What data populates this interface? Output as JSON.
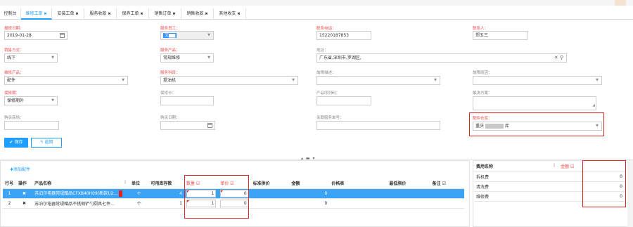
{
  "tabs": [
    {
      "label": "控制台",
      "closable": false,
      "active": false
    },
    {
      "label": "维修工单",
      "closable": true,
      "active": true
    },
    {
      "label": "安装工单",
      "closable": true,
      "active": false
    },
    {
      "label": "服务收款",
      "closable": true,
      "active": false
    },
    {
      "label": "保养工单",
      "closable": true,
      "active": false
    },
    {
      "label": "销售订单",
      "closable": true,
      "active": false
    },
    {
      "label": "销售收款",
      "closable": true,
      "active": false
    },
    {
      "label": "其他收支",
      "closable": true,
      "active": false
    }
  ],
  "form": {
    "report_date": {
      "label": "报修日期：",
      "value": "2019-01-28"
    },
    "service_staff": {
      "label": "服务员工：",
      "value": "文"
    },
    "phone": {
      "label": "联系电话：",
      "value": "15220187853"
    },
    "contact": {
      "label": "联系人：",
      "value": "郑五三"
    },
    "sale_method": {
      "label": "销售方式：",
      "value": "线下"
    },
    "service_product": {
      "label": "服务产品：",
      "value": "常规维修"
    },
    "address": {
      "label": "地址：",
      "value": "广东省,深圳市,罗湖区,"
    },
    "repair_product": {
      "label": "维修产品：",
      "value": "配件"
    },
    "service_subject": {
      "label": "服务科目：",
      "value": "提油机"
    },
    "fault_desc": {
      "label": "故障描述：",
      "value": ""
    },
    "fault_reason": {
      "label": "故障原因：",
      "value": ""
    },
    "warranty": {
      "label": "保修期：",
      "value": "保修期外"
    },
    "warranty_card": {
      "label": "保修卡：",
      "value": ""
    },
    "product_serial": {
      "label": "产品序列码：",
      "value": ""
    },
    "solution": {
      "label": "解决方案：",
      "value": ""
    },
    "purchase_store": {
      "label": "购买商场：",
      "value": ""
    },
    "purchase_date": {
      "label": "购买日期：",
      "value": ""
    },
    "related_service_no": {
      "label": "关联服务单号：",
      "value": ""
    },
    "parts_warehouse": {
      "label": "配件仓库：",
      "value_prefix": "重庆",
      "value_suffix": "库"
    }
  },
  "buttons": {
    "save": "✔ 保存",
    "back": "↰ 返回",
    "add_part": "✚添加配件"
  },
  "parts_table": {
    "headers": [
      "行号",
      "操作",
      "产品名称",
      "单位",
      "可用库存数",
      "数量 ☑",
      "单价 ☑",
      "标准供价",
      "金额",
      "价格表",
      "最低限价",
      "备注 ☑"
    ],
    "rows": [
      {
        "no": "1",
        "op": "✖",
        "name": "苏泊尔电器常规赠品CFXB40H09(新款)/2...",
        "unit": "个",
        "stock": "4",
        "qty": "1",
        "price": "0",
        "std": "",
        "amount": "0",
        "pricelist": "",
        "minprice": "",
        "remark": ""
      },
      {
        "no": "2",
        "op": "✖",
        "name": "苏泊尔电器常规赠品不锈钢铲勺厨具七件...",
        "unit": "个",
        "stock": "1",
        "qty": "1",
        "price": "0",
        "std": "",
        "amount": "0",
        "pricelist": "",
        "minprice": "",
        "remark": ""
      }
    ]
  },
  "fee_table": {
    "headers": [
      "费用名称",
      "金额 ☑"
    ],
    "rows": [
      {
        "name": "拆机费",
        "amount": "0"
      },
      {
        "name": "清洗费",
        "amount": "0"
      },
      {
        "name": "维修费",
        "amount": "0"
      }
    ]
  },
  "colors": {
    "accent": "#1e9fff",
    "required_label": "#ee4b4b",
    "highlight_box": "#e02424",
    "selected_row": "#3ca3f5"
  }
}
